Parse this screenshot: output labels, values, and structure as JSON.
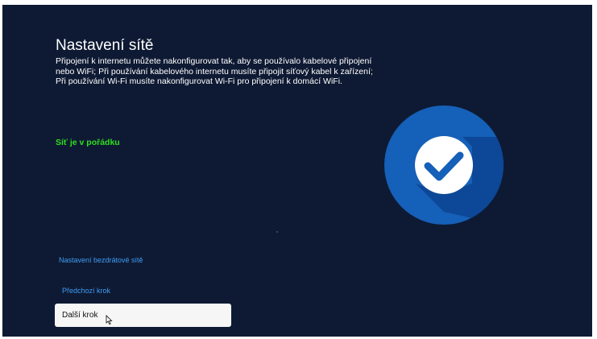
{
  "setup": {
    "title": "Nastavení sítě",
    "description": "Připojení k internetu můžete nakonfigurovat tak, aby se používalo kabelové připojení nebo WiFi; Při používání kabelového internetu musíte připojit síťový kabel k zařízení; Při používání Wi-Fi musíte nakonfigurovat Wi-Fi pro připojení k domácí WiFi.",
    "status": "Síť je v pořádku",
    "status_icon": "checkmark-circle-icon",
    "links": {
      "wireless_settings": "Nastavení bezdrátové sítě",
      "previous_step": "Předchozí krok"
    },
    "next_button": "Další krok"
  },
  "colors": {
    "background": "#0e1a33",
    "status_green": "#2fe01e",
    "link_blue": "#3f9df6",
    "circle_blue": "#1560b8"
  }
}
